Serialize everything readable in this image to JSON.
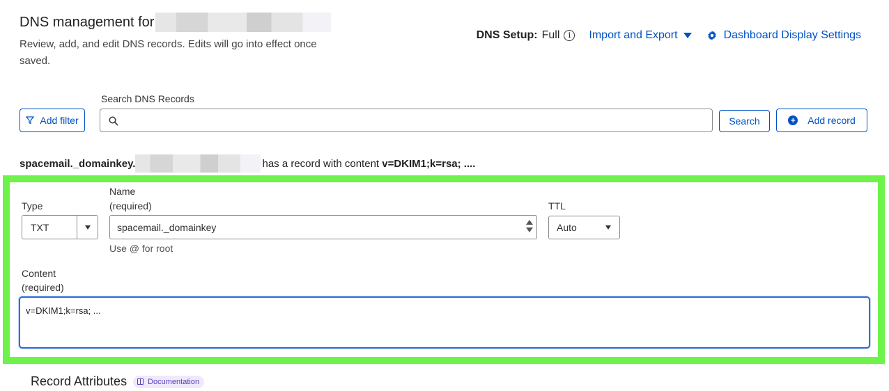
{
  "header": {
    "title": "DNS management for",
    "subtitle": "Review, add, and edit DNS records. Edits will go into effect once saved.",
    "dns_setup_label": "DNS Setup:",
    "dns_setup_value": "Full",
    "import_export_label": "Import and Export",
    "dashboard_settings_label": "Dashboard Display Settings"
  },
  "toolbar": {
    "search_label": "Search DNS Records",
    "add_filter_label": "Add filter",
    "search_placeholder": "",
    "search_button_label": "Search",
    "add_record_label": "Add record"
  },
  "record_summary": {
    "name": "spacemail._domainkey.",
    "middle_text": "has a record with content",
    "content": "v=DKIM1;k=rsa; ...."
  },
  "form": {
    "type_label": "Type",
    "type_value": "TXT",
    "name_label_line1": "Name",
    "name_label_line2": "(required)",
    "name_value": "spacemail._domainkey",
    "name_help": "Use @ for root",
    "ttl_label": "TTL",
    "ttl_value": "Auto",
    "content_label_line1": "Content",
    "content_label_line2": "(required)",
    "content_value": "v=DKIM1;k=rsa; ..."
  },
  "attributes": {
    "title": "Record Attributes",
    "documentation_label": "Documentation"
  },
  "colors": {
    "link": "#0051c3",
    "highlight_frame": "#6df34a",
    "focus_border": "#2f6fd6"
  }
}
